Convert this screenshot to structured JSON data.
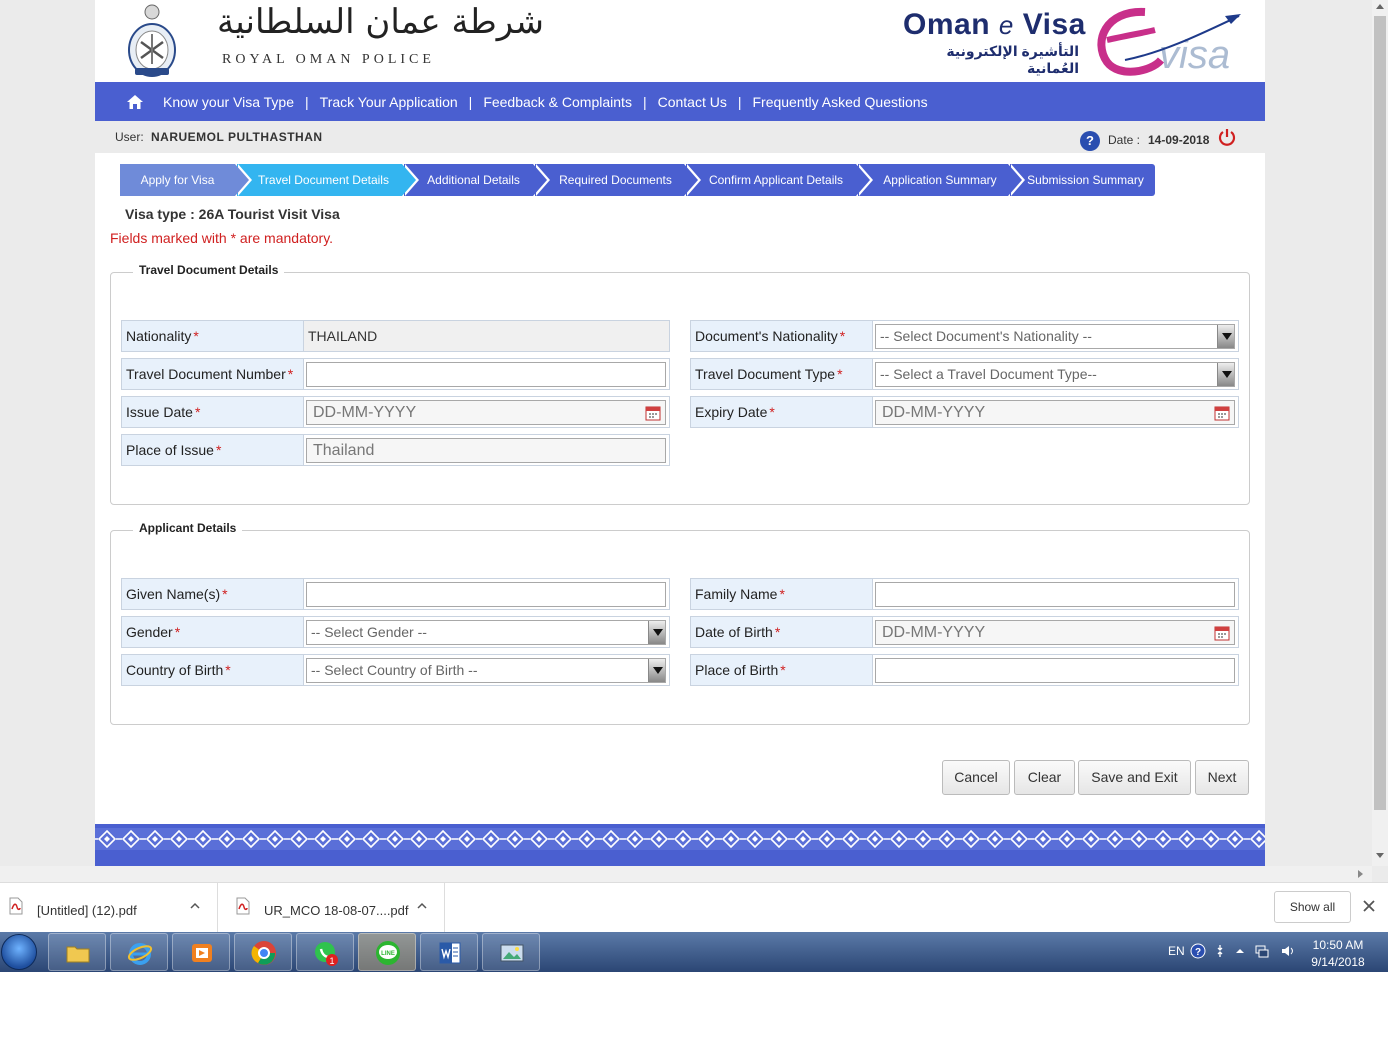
{
  "header": {
    "police_arabic": "شرطة عمان السلطانية",
    "police_english": "ROYAL OMAN POLICE",
    "evisa_title_1": "Oman",
    "evisa_title_e": "e",
    "evisa_title_2": "Visa",
    "evisa_arabic": "التأشيرة الإلكترونية العُمانية"
  },
  "nav": {
    "items": [
      "Know your Visa Type",
      "Track Your Application",
      "Feedback & Complaints",
      "Contact Us",
      "Frequently Asked Questions"
    ],
    "separator": "|"
  },
  "userbar": {
    "user_label": "User:",
    "user_name": "NARUEMOL  PULTHASTHAN",
    "help": "?",
    "date_label": "Date :",
    "date_value": "14-09-2018"
  },
  "steps": [
    "Apply for Visa",
    "Travel Document Details",
    "Additional Details",
    "Required Documents",
    "Confirm Applicant Details",
    "Application Summary",
    "Submission Summary"
  ],
  "visa_type": "Visa type : 26A Tourist Visit Visa",
  "mandatory_note": "Fields marked with * are mandatory.",
  "travel_section": {
    "title": "Travel Document Details",
    "nationality_label": "Nationality",
    "nationality_value": "THAILAND",
    "doc_nationality_label": "Document's Nationality",
    "doc_nationality_select": "-- Select Document's Nationality --",
    "doc_number_label": "Travel Document Number",
    "doc_type_label": "Travel Document Type",
    "doc_type_select": "-- Select a Travel Document Type--",
    "issue_date_label": "Issue Date",
    "issue_date_placeholder": "DD-MM-YYYY",
    "expiry_date_label": "Expiry Date",
    "expiry_date_placeholder": "DD-MM-YYYY",
    "place_issue_label": "Place of Issue",
    "place_issue_value": "Thailand"
  },
  "applicant_section": {
    "title": "Applicant Details",
    "given_name_label": "Given Name(s)",
    "family_name_label": "Family Name",
    "gender_label": "Gender",
    "gender_select": "-- Select Gender --",
    "dob_label": "Date of Birth",
    "dob_placeholder": "DD-MM-YYYY",
    "country_birth_label": "Country of Birth",
    "country_birth_select": "-- Select Country of Birth --",
    "place_birth_label": "Place of Birth"
  },
  "required_mark": "*",
  "buttons": {
    "cancel": "Cancel",
    "clear": "Clear",
    "save_exit": "Save and Exit",
    "next": "Next"
  },
  "downloads": {
    "file1": "[Untitled] (12).pdf",
    "file2": "UR_MCO 18-08-07....pdf",
    "show_all": "Show all"
  },
  "taskbar": {
    "whatsapp_badge": "1",
    "line_label": "LINE",
    "lang": "EN",
    "time": "10:50 AM",
    "date": "9/14/2018"
  },
  "colors": {
    "nav_blue": "#4a5fd0",
    "step_active": "#33b5f0",
    "required_red": "#d02020",
    "label_bg": "#e8f1fb"
  }
}
